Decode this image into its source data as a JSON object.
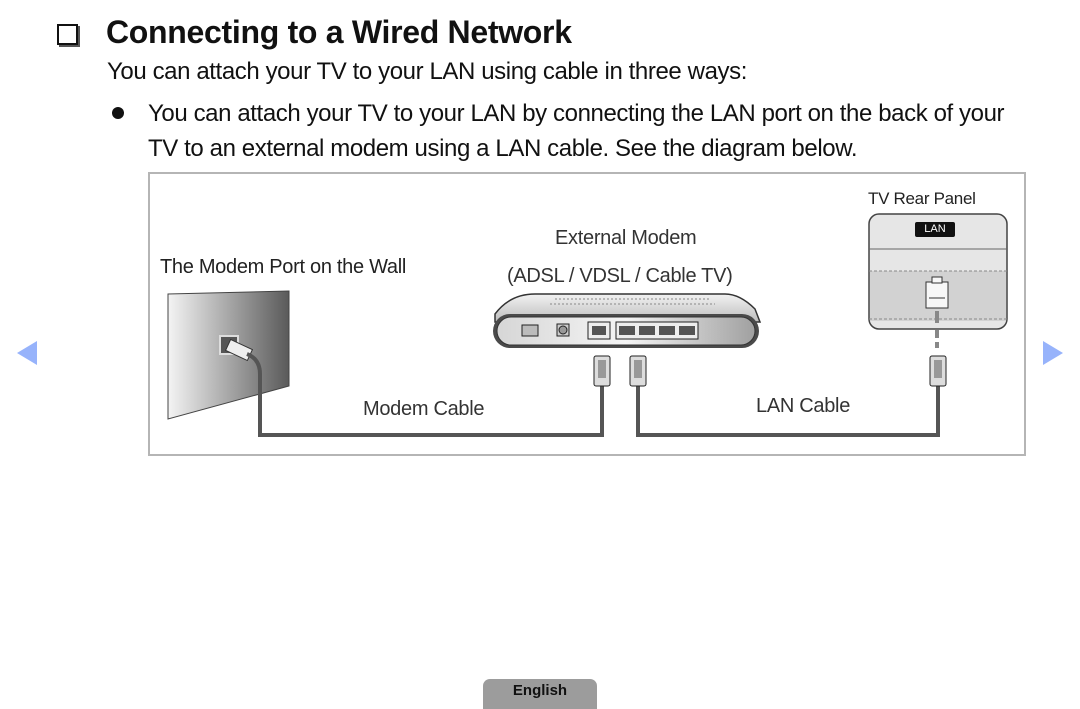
{
  "section": {
    "title": "Connecting to a Wired Network",
    "intro": "You can attach your TV to your LAN using cable in three ways:",
    "bullets": [
      "You can attach your TV to your LAN by connecting the LAN port on the back of your TV to an external modem using a LAN cable. See the diagram below."
    ]
  },
  "diagram": {
    "wall_label": "The Modem Port on the Wall",
    "modem_label_line1": "External Modem",
    "modem_label_line2": "(ADSL / VDSL / Cable TV)",
    "tv_panel_label": "TV Rear Panel",
    "lan_badge": "LAN",
    "modem_cable_label": "Modem Cable",
    "lan_cable_label": "LAN Cable"
  },
  "navigation": {
    "prev_icon": "triangle-left-icon",
    "next_icon": "triangle-right-icon",
    "arrow_color": "#97b3fb"
  },
  "footer": {
    "language": "English"
  }
}
